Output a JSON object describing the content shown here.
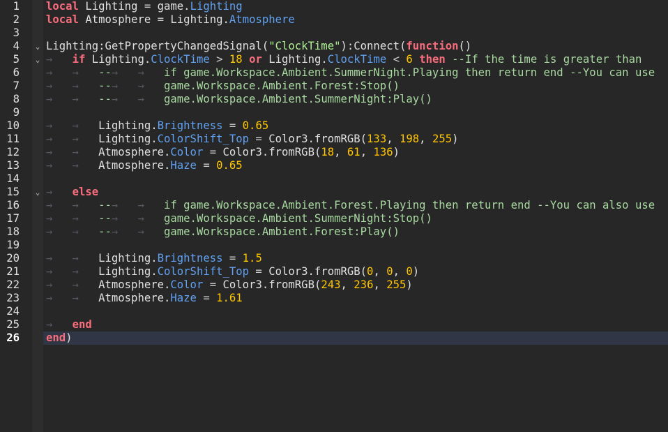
{
  "editor": {
    "current_line": 26,
    "colors": {
      "background": "#272727",
      "keyword": "#f86d7c",
      "property": "#61a1f1",
      "string": "#adf195",
      "number": "#ffc600",
      "text": "#e0e0e0",
      "current_line_bg": "#303645"
    },
    "fold_icon": "chevron-down-icon",
    "tab_arrow": "→",
    "lines": [
      {
        "num": 1,
        "fold": false,
        "tokens": [
          [
            "kw",
            "local"
          ],
          [
            "id",
            " Lighting "
          ],
          [
            "op",
            "="
          ],
          [
            "id",
            " game."
          ],
          [
            "pr",
            "Lighting"
          ]
        ]
      },
      {
        "num": 2,
        "fold": false,
        "tokens": [
          [
            "kw",
            "local"
          ],
          [
            "id",
            " Atmosphere "
          ],
          [
            "op",
            "="
          ],
          [
            "id",
            " Lighting."
          ],
          [
            "pr",
            "Atmosphere"
          ]
        ]
      },
      {
        "num": 3,
        "fold": false,
        "tokens": []
      },
      {
        "num": 4,
        "fold": true,
        "tokens": [
          [
            "id",
            "Lighting:GetPropertyChangedSignal("
          ],
          [
            "st",
            "\"ClockTime\""
          ],
          [
            "id",
            "):Connect("
          ],
          [
            "kw",
            "function"
          ],
          [
            "id",
            "()"
          ]
        ]
      },
      {
        "num": 5,
        "fold": true,
        "tokens": [
          [
            "ar",
            "→   "
          ],
          [
            "kw",
            "if"
          ],
          [
            "id",
            " Lighting."
          ],
          [
            "pr",
            "ClockTime"
          ],
          [
            "op",
            " > "
          ],
          [
            "nm",
            "18"
          ],
          [
            "id",
            " "
          ],
          [
            "kw",
            "or"
          ],
          [
            "id",
            " Lighting."
          ],
          [
            "pr",
            "ClockTime"
          ],
          [
            "op",
            " < "
          ],
          [
            "nm",
            "6"
          ],
          [
            "id",
            " "
          ],
          [
            "kw",
            "then"
          ],
          [
            "cm",
            " --If the time is greater than"
          ]
        ]
      },
      {
        "num": 6,
        "fold": false,
        "tokens": [
          [
            "ar",
            "→   →   "
          ],
          [
            "cm",
            "--"
          ],
          [
            "ar",
            "→   →   "
          ],
          [
            "cm",
            "if game.Workspace.Ambient.SummerNight.Playing then return end --You can use"
          ]
        ]
      },
      {
        "num": 7,
        "fold": false,
        "tokens": [
          [
            "ar",
            "→   →   "
          ],
          [
            "cm",
            "--"
          ],
          [
            "ar",
            "→   →   "
          ],
          [
            "cm",
            "game.Workspace.Ambient.Forest:Stop()"
          ]
        ]
      },
      {
        "num": 8,
        "fold": false,
        "tokens": [
          [
            "ar",
            "→   →   "
          ],
          [
            "cm",
            "--"
          ],
          [
            "ar",
            "→   →   "
          ],
          [
            "cm",
            "game.Workspace.Ambient.SummerNight:Play()"
          ]
        ]
      },
      {
        "num": 9,
        "fold": false,
        "tokens": []
      },
      {
        "num": 10,
        "fold": false,
        "tokens": [
          [
            "ar",
            "→   →   "
          ],
          [
            "id",
            "Lighting."
          ],
          [
            "pr",
            "Brightness"
          ],
          [
            "op",
            " = "
          ],
          [
            "nm",
            "0.65"
          ]
        ]
      },
      {
        "num": 11,
        "fold": false,
        "tokens": [
          [
            "ar",
            "→   →   "
          ],
          [
            "id",
            "Lighting."
          ],
          [
            "pr",
            "ColorShift_Top"
          ],
          [
            "op",
            " = "
          ],
          [
            "id",
            "Color3.fromRGB("
          ],
          [
            "nm",
            "133"
          ],
          [
            "id",
            ", "
          ],
          [
            "nm",
            "198"
          ],
          [
            "id",
            ", "
          ],
          [
            "nm",
            "255"
          ],
          [
            "id",
            ")"
          ]
        ]
      },
      {
        "num": 12,
        "fold": false,
        "tokens": [
          [
            "ar",
            "→   →   "
          ],
          [
            "id",
            "Atmosphere."
          ],
          [
            "pr",
            "Color"
          ],
          [
            "op",
            " = "
          ],
          [
            "id",
            "Color3.fromRGB("
          ],
          [
            "nm",
            "18"
          ],
          [
            "id",
            ", "
          ],
          [
            "nm",
            "61"
          ],
          [
            "id",
            ", "
          ],
          [
            "nm",
            "136"
          ],
          [
            "id",
            ")"
          ]
        ]
      },
      {
        "num": 13,
        "fold": false,
        "tokens": [
          [
            "ar",
            "→   →   "
          ],
          [
            "id",
            "Atmosphere."
          ],
          [
            "pr",
            "Haze"
          ],
          [
            "op",
            " = "
          ],
          [
            "nm",
            "0.65"
          ]
        ]
      },
      {
        "num": 14,
        "fold": false,
        "tokens": []
      },
      {
        "num": 15,
        "fold": true,
        "tokens": [
          [
            "ar",
            "→   "
          ],
          [
            "kw",
            "else"
          ]
        ]
      },
      {
        "num": 16,
        "fold": false,
        "tokens": [
          [
            "ar",
            "→   →   "
          ],
          [
            "cm",
            "--"
          ],
          [
            "ar",
            "→   →   "
          ],
          [
            "cm",
            "if game.Workspace.Ambient.Forest.Playing then return end --You can also use"
          ]
        ]
      },
      {
        "num": 17,
        "fold": false,
        "tokens": [
          [
            "ar",
            "→   →   "
          ],
          [
            "cm",
            "--"
          ],
          [
            "ar",
            "→   →   "
          ],
          [
            "cm",
            "game.Workspace.Ambient.SummerNight:Stop()"
          ]
        ]
      },
      {
        "num": 18,
        "fold": false,
        "tokens": [
          [
            "ar",
            "→   →   "
          ],
          [
            "cm",
            "--"
          ],
          [
            "ar",
            "→   →   "
          ],
          [
            "cm",
            "game.Workspace.Ambient.Forest:Play()"
          ]
        ]
      },
      {
        "num": 19,
        "fold": false,
        "tokens": []
      },
      {
        "num": 20,
        "fold": false,
        "tokens": [
          [
            "ar",
            "→   →   "
          ],
          [
            "id",
            "Lighting."
          ],
          [
            "pr",
            "Brightness"
          ],
          [
            "op",
            " = "
          ],
          [
            "nm",
            "1.5"
          ]
        ]
      },
      {
        "num": 21,
        "fold": false,
        "tokens": [
          [
            "ar",
            "→   →   "
          ],
          [
            "id",
            "Lighting."
          ],
          [
            "pr",
            "ColorShift_Top"
          ],
          [
            "op",
            " = "
          ],
          [
            "id",
            "Color3.fromRGB("
          ],
          [
            "nm",
            "0"
          ],
          [
            "id",
            ", "
          ],
          [
            "nm",
            "0"
          ],
          [
            "id",
            ", "
          ],
          [
            "nm",
            "0"
          ],
          [
            "id",
            ")"
          ]
        ]
      },
      {
        "num": 22,
        "fold": false,
        "tokens": [
          [
            "ar",
            "→   →   "
          ],
          [
            "id",
            "Atmosphere."
          ],
          [
            "pr",
            "Color"
          ],
          [
            "op",
            " = "
          ],
          [
            "id",
            "Color3.fromRGB("
          ],
          [
            "nm",
            "243"
          ],
          [
            "id",
            ", "
          ],
          [
            "nm",
            "236"
          ],
          [
            "id",
            ", "
          ],
          [
            "nm",
            "255"
          ],
          [
            "id",
            ")"
          ]
        ]
      },
      {
        "num": 23,
        "fold": false,
        "tokens": [
          [
            "ar",
            "→   →   "
          ],
          [
            "id",
            "Atmosphere."
          ],
          [
            "pr",
            "Haze"
          ],
          [
            "op",
            " = "
          ],
          [
            "nm",
            "1.61"
          ]
        ]
      },
      {
        "num": 24,
        "fold": false,
        "tokens": []
      },
      {
        "num": 25,
        "fold": false,
        "tokens": [
          [
            "ar",
            "→   "
          ],
          [
            "kw",
            "end"
          ]
        ]
      },
      {
        "num": 26,
        "fold": false,
        "tokens": [
          [
            "kw",
            "end"
          ],
          [
            "id",
            ")"
          ]
        ]
      }
    ]
  }
}
